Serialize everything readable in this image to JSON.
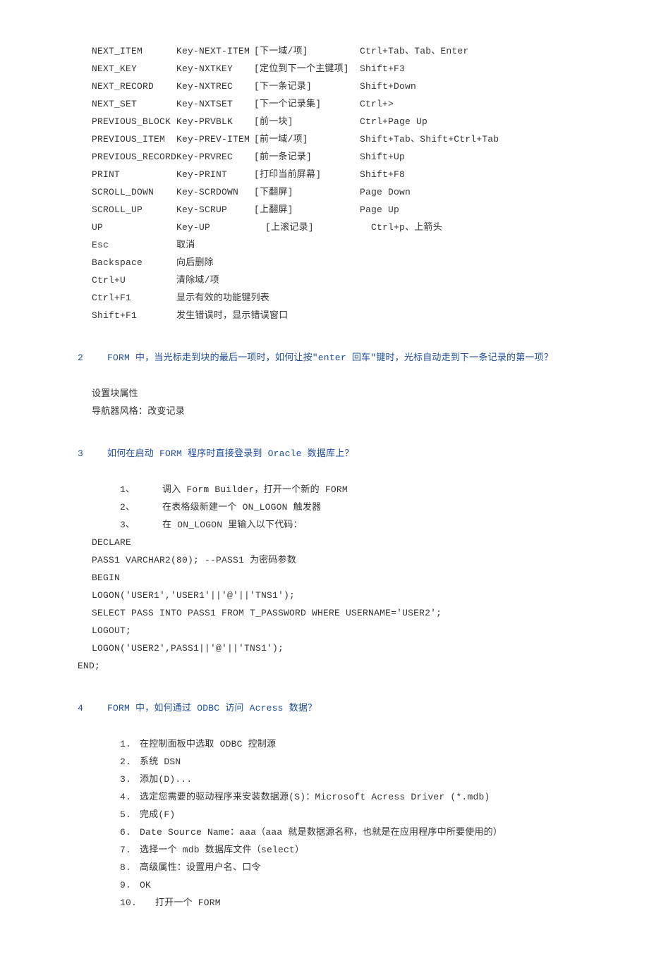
{
  "table": [
    {
      "c1": "NEXT_ITEM",
      "c2": "Key-NEXT-ITEM",
      "c3": "[下一域/项]",
      "c4": "Ctrl+Tab、Tab、Enter"
    },
    {
      "c1": "NEXT_KEY",
      "c2": "Key-NXTKEY",
      "c3": "[定位到下一个主键项]",
      "c4": "Shift+F3"
    },
    {
      "c1": "NEXT_RECORD",
      "c2": "Key-NXTREC",
      "c3": "[下一条记录]",
      "c4": "Shift+Down"
    },
    {
      "c1": "NEXT_SET",
      "c2": "Key-NXTSET",
      "c3": "[下一个记录集]",
      "c4": "Ctrl+>"
    },
    {
      "c1": "PREVIOUS_BLOCK",
      "c2": "Key-PRVBLK",
      "c3": "[前一块]",
      "c4": "Ctrl+Page Up"
    },
    {
      "c1": "PREVIOUS_ITEM",
      "c2": "Key-PREV-ITEM",
      "c3": "[前一域/项]",
      "c4": "Shift+Tab、Shift+Ctrl+Tab"
    },
    {
      "c1": "PREVIOUS_RECORD",
      "c2": "Key-PRVREC",
      "c3": "[前一条记录]",
      "c4": "Shift+Up"
    },
    {
      "c1": "PRINT",
      "c2": "Key-PRINT",
      "c3": "[打印当前屏幕]",
      "c4": "Shift+F8"
    },
    {
      "c1": "SCROLL_DOWN",
      "c2": "Key-SCRDOWN",
      "c3": "[下翻屏]",
      "c4": "Page Down"
    },
    {
      "c1": "SCROLL_UP",
      "c2": "Key-SCRUP",
      "c3": "[上翻屏]",
      "c4": "Page Up"
    },
    {
      "c1": "UP",
      "c2": "Key-UP",
      "c3": "  [上滚记录]",
      "c4": "  Ctrl+p、上箭头"
    },
    {
      "c1": "Esc",
      "c2": "取消",
      "c3": "",
      "c4": ""
    },
    {
      "c1": "Backspace",
      "c2": "向后删除",
      "c3": "",
      "c4": ""
    },
    {
      "c1": "Ctrl+U",
      "c2": "清除域/项",
      "c3": "",
      "c4": ""
    },
    {
      "c1": "Ctrl+F1",
      "c2": "显示有效的功能键列表",
      "c3": "",
      "c4": ""
    },
    {
      "c1": "Shift+F1",
      "c2": "发生错误时，显示错误窗口",
      "c3": "",
      "c4": ""
    }
  ],
  "h2": {
    "n": "2",
    "t": "FORM 中，当光标走到块的最后一项时，如何让按\"enter 回车\"键时，光标自动走到下一条记录的第一项？"
  },
  "p2a": "设置块属性",
  "p2b": "导航器风格：改变记录",
  "h3": {
    "n": "3",
    "t": "如何在启动 FORM 程序时直接登录到 Oracle 数据库上？"
  },
  "s3": [
    {
      "n": "1、",
      "t": "调入 Form Builder，打开一个新的 FORM"
    },
    {
      "n": "2、",
      "t": "在表格级新建一个 ON_LOGON 触发器"
    },
    {
      "n": "3、",
      "t": "在 ON_LOGON 里输入以下代码："
    }
  ],
  "code": [
    "DECLARE",
    "PASS1 VARCHAR2(80); --PASS1 为密码参数",
    "BEGIN",
    "LOGON('USER1','USER1'||'@'||'TNS1');",
    "SELECT PASS INTO PASS1 FROM T_PASSWORD WHERE USERNAME='USER2';",
    "LOGOUT;",
    "LOGON('USER2',PASS1||'@'||'TNS1');"
  ],
  "codeEnd": "END;",
  "h4": {
    "n": "4",
    "t": "FORM 中，如何通过 ODBC 访问 Acress 数据？"
  },
  "s4": [
    {
      "n": "1.",
      "t": "在控制面板中选取 ODBC 控制源"
    },
    {
      "n": "2.",
      "t": "系统 DSN"
    },
    {
      "n": "3.",
      "t": "添加(D)..."
    },
    {
      "n": "4.",
      "t": "选定您需要的驱动程序来安装数据源(S)：Microsoft Acress Driver (*.mdb)"
    },
    {
      "n": "5.",
      "t": "完成(F)"
    },
    {
      "n": "6.",
      "t": "Date Source Name：aaa（aaa 就是数据源名称，也就是在应用程序中所要使用的）"
    },
    {
      "n": "7.",
      "t": "选择一个 mdb 数据库文件（select）"
    },
    {
      "n": "8.",
      "t": "高级属性：设置用户名、口令"
    },
    {
      "n": "9.",
      "t": "OK"
    }
  ],
  "s4last": {
    "n": "10.",
    "t": "打开一个 FORM"
  }
}
